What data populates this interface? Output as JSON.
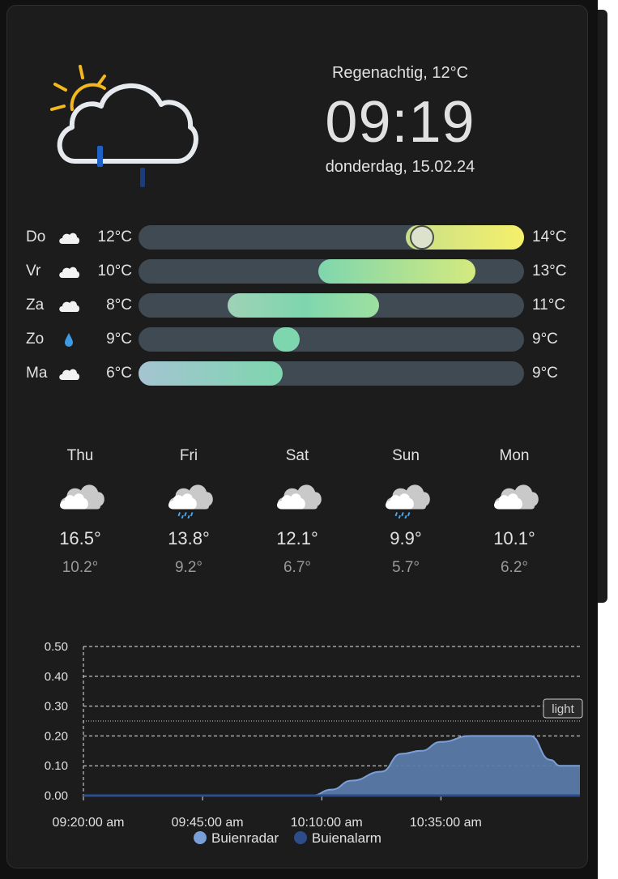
{
  "header": {
    "condition": "Regenachtig, 12°C",
    "time": "09:19",
    "date": "donderdag, 15.02.24"
  },
  "daily_bars": [
    {
      "day": "Do",
      "icon": "cloud-icon",
      "low": "12°C",
      "high": "14°C",
      "low_value": 12,
      "high_value": 14,
      "current_value": 12
    },
    {
      "day": "Vr",
      "icon": "cloud-icon",
      "low": "10°C",
      "high": "13°C",
      "low_value": 10,
      "high_value": 13
    },
    {
      "day": "Za",
      "icon": "cloud-icon",
      "low": "8°C",
      "high": "11°C",
      "low_value": 8,
      "high_value": 11
    },
    {
      "day": "Zo",
      "icon": "raindrop-icon",
      "low": "9°C",
      "high": "9°C",
      "low_value": 9,
      "high_value": 9
    },
    {
      "day": "Ma",
      "icon": "cloud-icon",
      "low": "6°C",
      "high": "9°C",
      "low_value": 6,
      "high_value": 9
    }
  ],
  "bar_scale": {
    "min": 6,
    "max": 14
  },
  "forecast": [
    {
      "day": "Thu",
      "icon": "cloudy-icon",
      "high": "16.5°",
      "low": "10.2°"
    },
    {
      "day": "Fri",
      "icon": "cloudy-rain-icon",
      "high": "13.8°",
      "low": "9.2°"
    },
    {
      "day": "Sat",
      "icon": "cloudy-icon",
      "high": "12.1°",
      "low": "6.7°"
    },
    {
      "day": "Sun",
      "icon": "cloudy-rain-icon",
      "high": "9.9°",
      "low": "5.7°"
    },
    {
      "day": "Mon",
      "icon": "cloudy-icon",
      "high": "10.1°",
      "low": "6.2°"
    }
  ],
  "colors": {
    "card": "#1c1c1c",
    "track": "#404a53",
    "bar_warm": "#f5f06a",
    "bar_mid": "#7ed6ae",
    "bar_cool": "#a4c4d2",
    "area_fill": "#5a7aa8",
    "area_line": "#7a9fd8",
    "alarm": "#2c4d8a"
  },
  "chart_data": {
    "type": "area",
    "x_ticks": [
      "09:20:00 am",
      "09:45:00 am",
      "10:10:00 am",
      "10:35:00 am"
    ],
    "y_ticks": [
      "0.00",
      "0.10",
      "0.20",
      "0.30",
      "0.40",
      "0.50"
    ],
    "ylim": [
      0,
      0.5
    ],
    "x_minutes": [
      0,
      60,
      115,
      125,
      135,
      150,
      160,
      170,
      180,
      195,
      210,
      225,
      235,
      240,
      250
    ],
    "series": [
      {
        "name": "Buienradar",
        "color": "#7a9fd8",
        "x": [
          0,
          60,
          115,
          125,
          135,
          150,
          160,
          170,
          180,
          195,
          210,
          225,
          235,
          240,
          250
        ],
        "values": [
          0,
          0,
          0,
          0.02,
          0.05,
          0.08,
          0.14,
          0.15,
          0.18,
          0.2,
          0.2,
          0.2,
          0.12,
          0.1,
          0.1
        ]
      },
      {
        "name": "Buienalarm",
        "color": "#2c4d8a",
        "x": [
          0,
          250
        ],
        "values": [
          0,
          0
        ]
      }
    ],
    "threshold": {
      "label": "light",
      "value": 0.25
    },
    "grid": true,
    "legend": "bottom"
  }
}
